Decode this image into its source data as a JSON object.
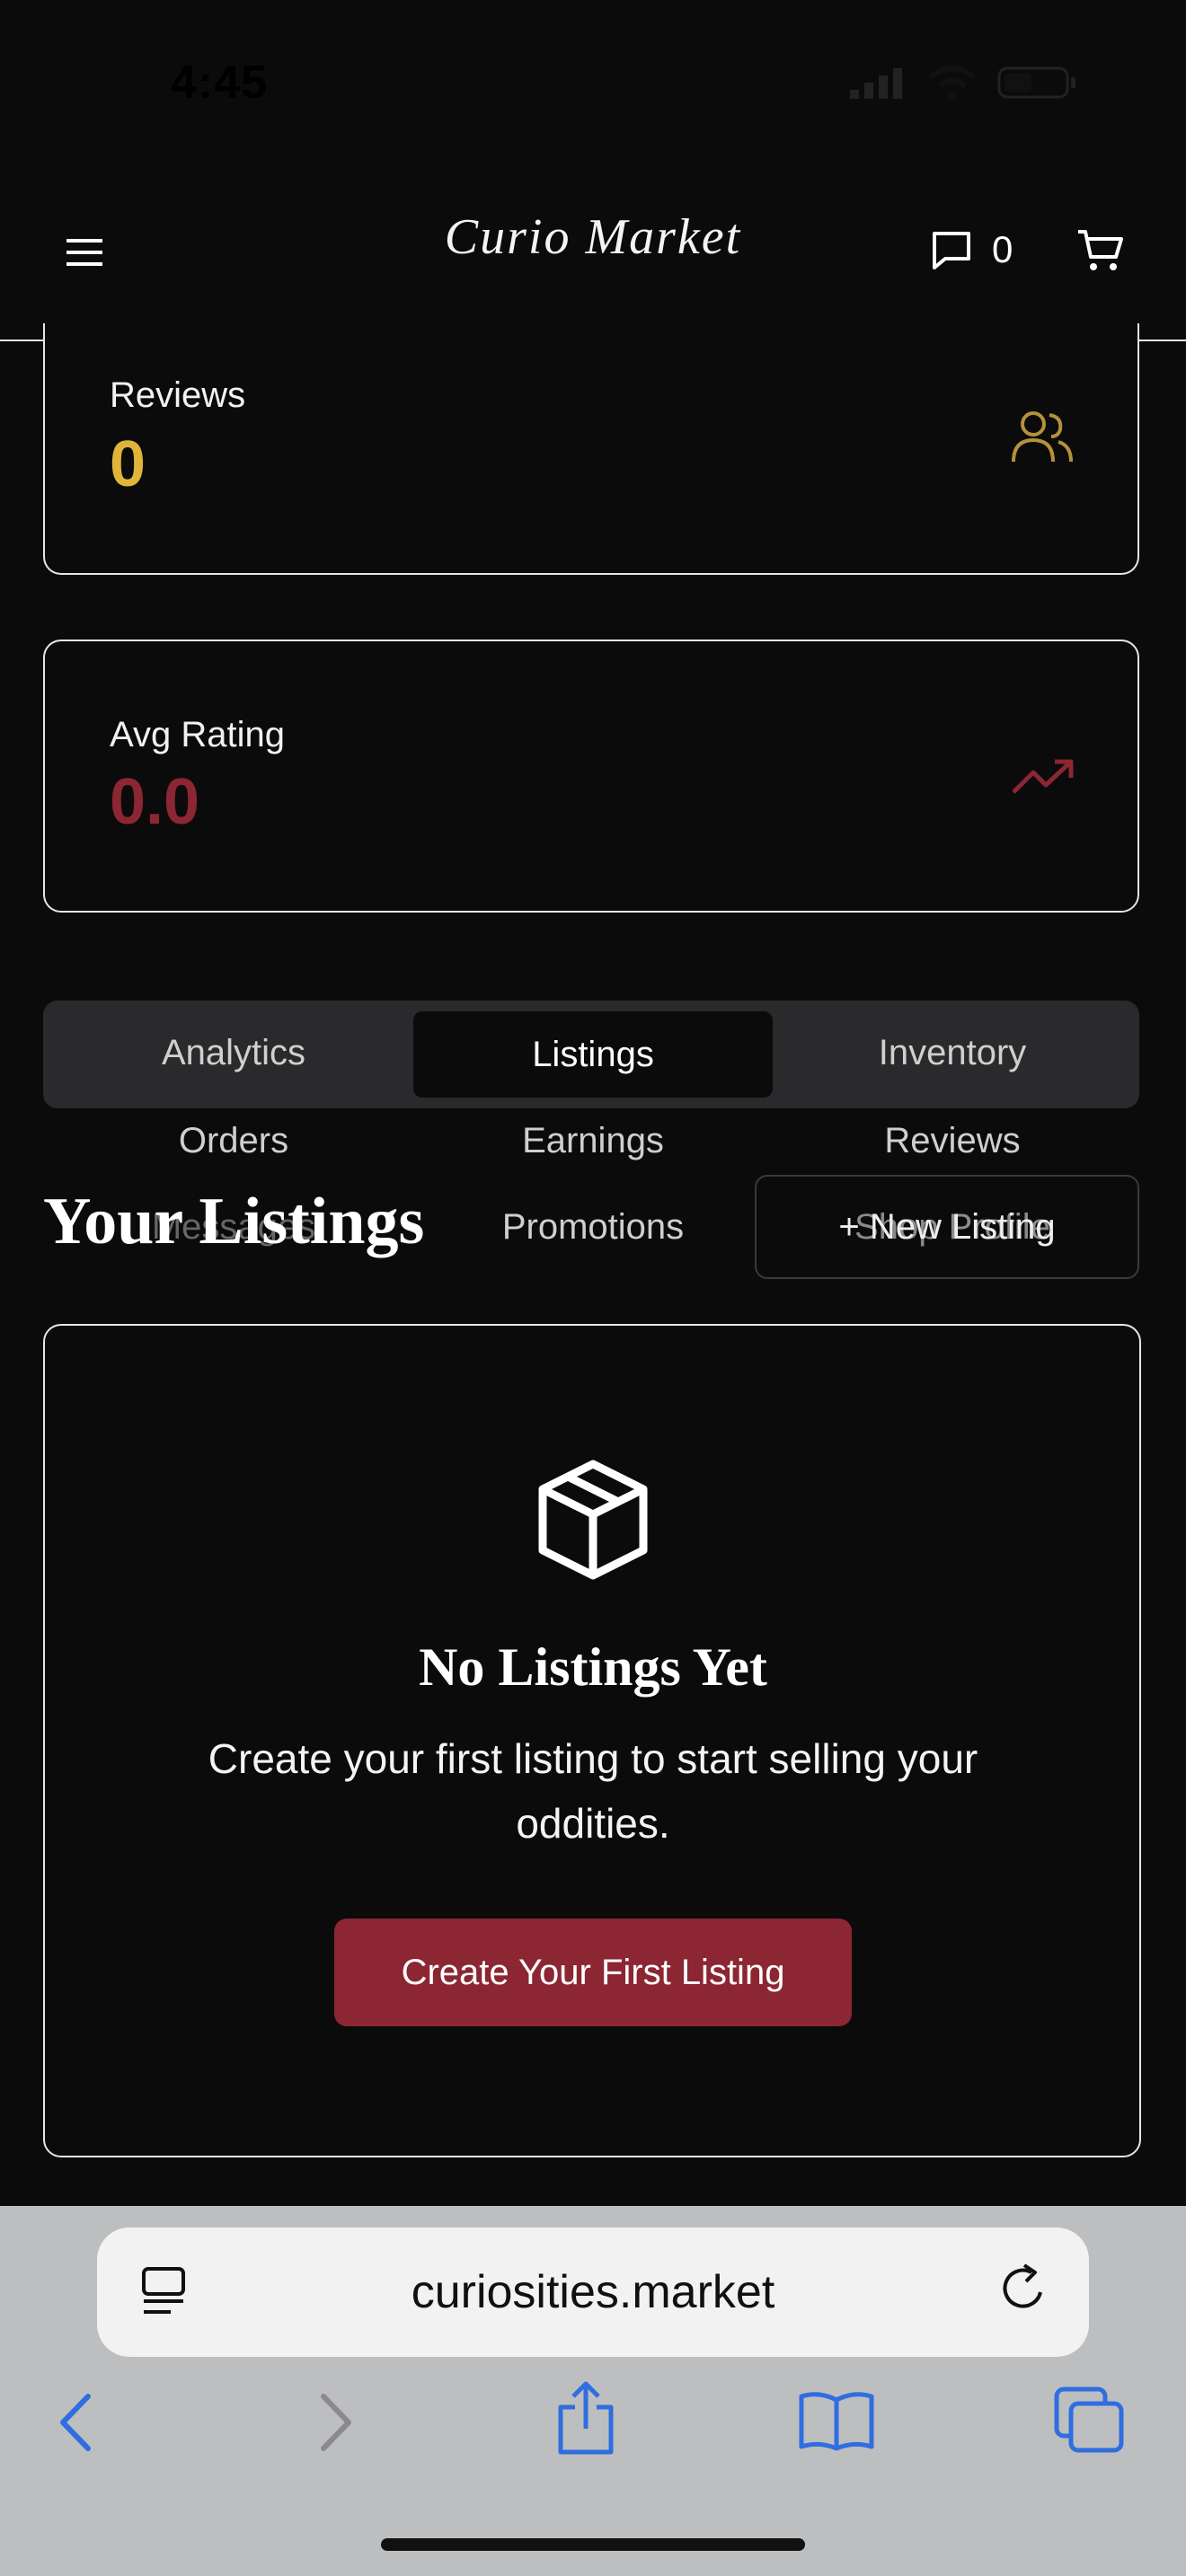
{
  "status_bar": {
    "time": "4:45"
  },
  "header": {
    "brand": "Curio Market",
    "message_count": "0"
  },
  "stats": [
    {
      "label": "Reviews",
      "value": "0",
      "color": "#e0b43a",
      "icon": "users-icon"
    },
    {
      "label": "Avg Rating",
      "value": "0.0",
      "color": "#8b2632",
      "icon": "trending-up-icon"
    }
  ],
  "tabs": {
    "row1": [
      "Analytics",
      "Listings",
      "Inventory"
    ],
    "active": "Listings",
    "row2": [
      "Orders",
      "Earnings",
      "Reviews"
    ],
    "row3": [
      "Messages",
      "Promotions",
      "Shop Profile"
    ]
  },
  "section": {
    "title": "Your Listings",
    "new_button": "+ New Listing"
  },
  "empty_state": {
    "icon": "box-icon",
    "title": "No Listings Yet",
    "text": "Create your first listing to start selling your oddities.",
    "button": "Create Your First Listing"
  },
  "browser": {
    "url": "curiosities.market"
  },
  "colors": {
    "accent_red": "#8b2632",
    "gold": "#e0b43a",
    "background": "#0b0b0c"
  }
}
